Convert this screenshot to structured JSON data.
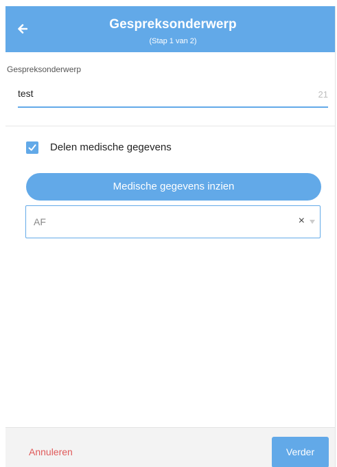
{
  "header": {
    "title": "Gespreksonderwerp",
    "subtitle": "(Stap 1 van 2)",
    "back_icon": "arrow-left-icon"
  },
  "topic": {
    "label": "Gespreksonderwerp",
    "value": "test",
    "remaining_chars": "21"
  },
  "share_medical": {
    "checked": true,
    "label": "Delen medische gegevens"
  },
  "medical_button": {
    "label": "Medische gegevens inzien"
  },
  "medical_select": {
    "selected": "AF"
  },
  "footer": {
    "cancel_label": "Annuleren",
    "next_label": "Verder"
  },
  "colors": {
    "accent": "#62a9e8",
    "cancel": "#e05a5a",
    "footer_bg": "#f3f3f3"
  }
}
